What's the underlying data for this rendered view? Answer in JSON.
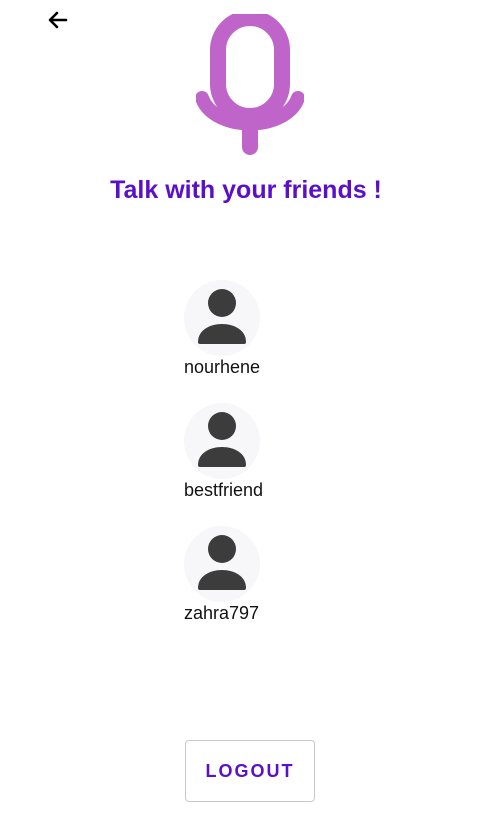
{
  "header": {
    "back_icon": "arrow-left-icon",
    "logo_icon": "microphone-icon",
    "title": "Talk with your friends !"
  },
  "friends": [
    {
      "name": "nourhene",
      "avatar_icon": "user-avatar-icon"
    },
    {
      "name": "bestfriend",
      "avatar_icon": "user-avatar-icon"
    },
    {
      "name": "zahra797",
      "avatar_icon": "user-avatar-icon"
    }
  ],
  "footer": {
    "logout_label": "LOGOUT"
  },
  "colors": {
    "accent": "#5a0fc8",
    "mic": "#bf64c8",
    "avatar_bg": "#f7f7f9",
    "avatar_figure": "#3c3c3c"
  }
}
